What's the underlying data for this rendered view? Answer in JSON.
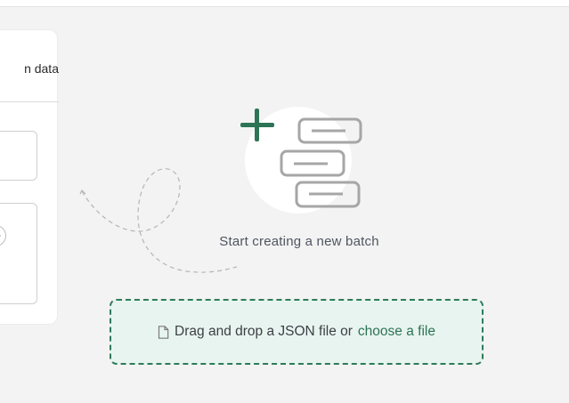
{
  "panel": {
    "label": "n data",
    "code_toggle_glyph": "<>"
  },
  "empty_state": {
    "title": "Start creating a new batch",
    "plus_color": "#2d7456",
    "illustration_icon": "batch-list-icon"
  },
  "dropzone": {
    "text": "Drag and drop a JSON file or",
    "link_text": "choose a file",
    "icon": "file-icon",
    "border_color": "#2f7a5c",
    "background": "#e8f4ef"
  }
}
